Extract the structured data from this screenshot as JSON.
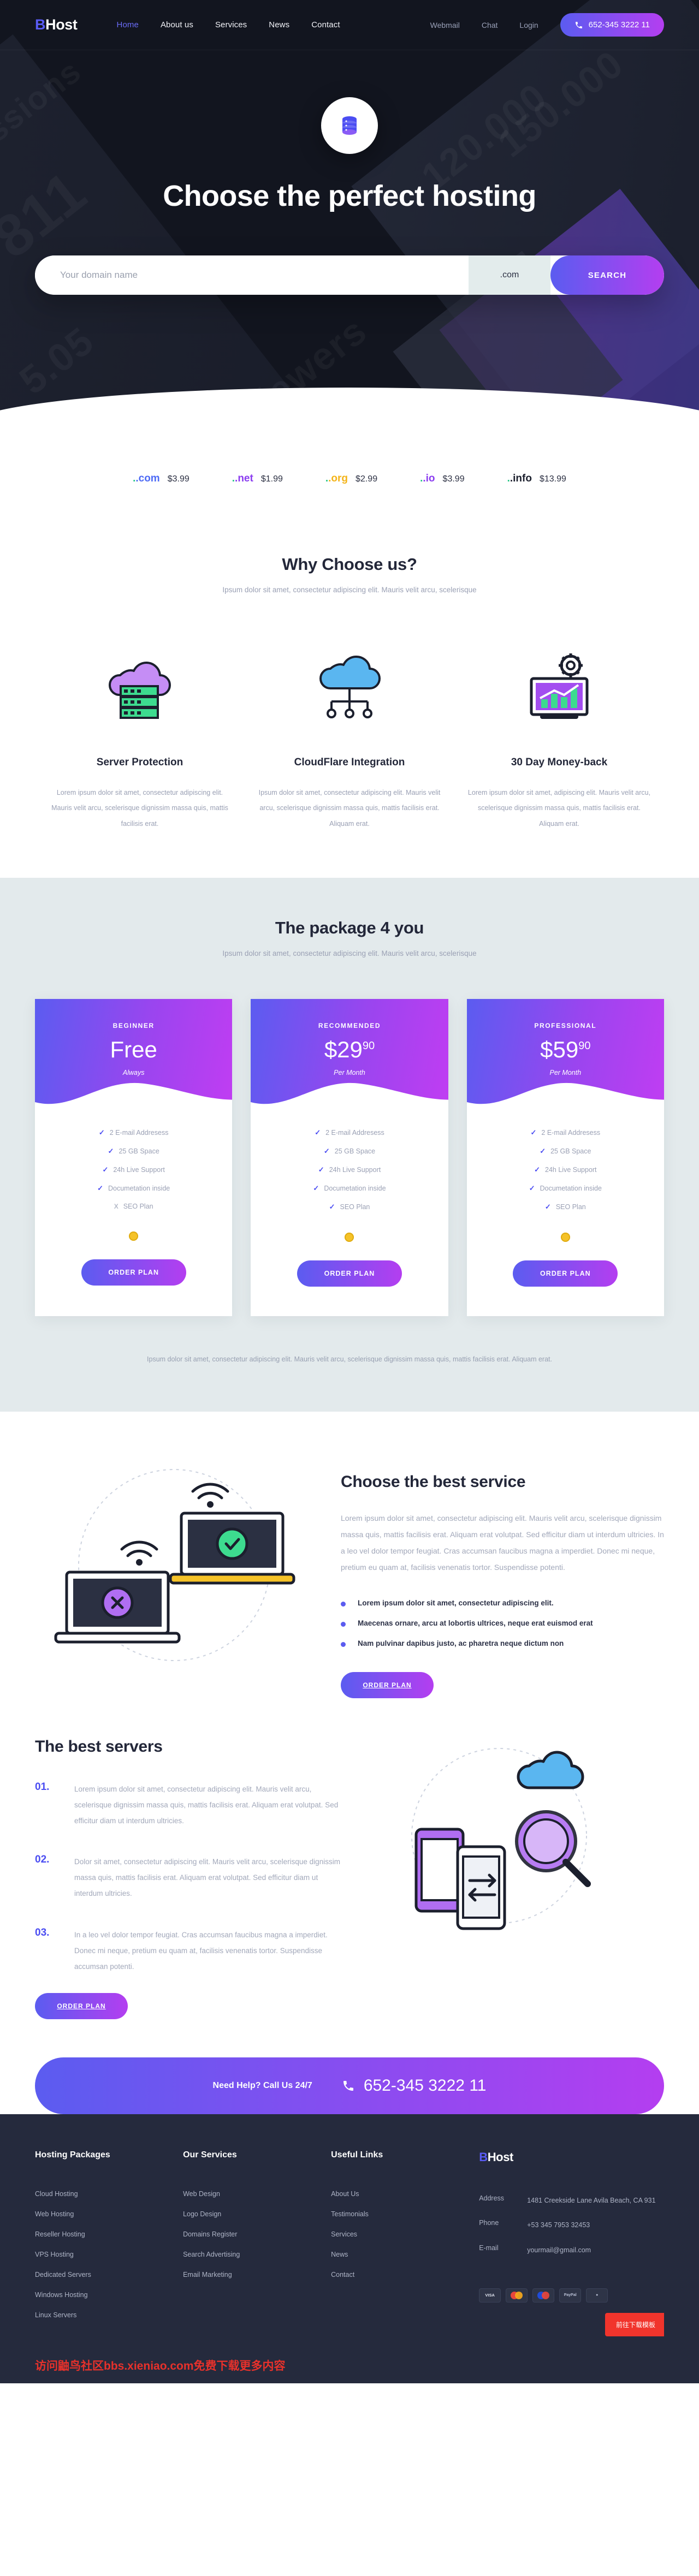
{
  "brand": {
    "prefix": "B",
    "suffix": "Host",
    "accent": "#5a5cf5"
  },
  "header": {
    "nav": [
      {
        "label": "Home",
        "active": true
      },
      {
        "label": "About us",
        "active": false
      },
      {
        "label": "Services",
        "active": false
      },
      {
        "label": "News",
        "active": false
      },
      {
        "label": "Contact",
        "active": false
      }
    ],
    "utility": [
      "Webmail",
      "Chat",
      "Login"
    ],
    "phone": "652-345 3222 11"
  },
  "hero": {
    "title": "Choose the perfect hosting",
    "bg_numbers": [
      "811",
      "5.05",
      "150.000",
      "120.000",
      "ssions",
      "viewers"
    ],
    "search": {
      "placeholder": "Your domain name",
      "value": "",
      "tld": ".com",
      "button": "SEARCH"
    }
  },
  "tlds": [
    {
      "name": ".com",
      "price": "$3.99",
      "color": "#4e6bf5"
    },
    {
      "name": ".net",
      "price": "$1.99",
      "color": "#8b3df0"
    },
    {
      "name": ".org",
      "price": "$2.99",
      "color": "#f4b41a"
    },
    {
      "name": ".io",
      "price": "$3.99",
      "color": "#8b3df0"
    },
    {
      "name": ".info",
      "price": "$13.99",
      "color": "#1b1f2d"
    }
  ],
  "why": {
    "title": "Why Choose us?",
    "subtitle": "Ipsum dolor sit amet, consectetur adipiscing elit. Mauris velit arcu, scelerisque",
    "features": [
      {
        "icon": "cloud-server-icon",
        "title": "Server Protection",
        "text": "Lorem ipsum dolor sit amet, consectetur adipiscing elit. Mauris velit arcu, scelerisque dignissim massa quis, mattis facilisis erat."
      },
      {
        "icon": "cloudflare-network-icon",
        "title": "CloudFlare Integration",
        "text": "Ipsum dolor sit amet, consectetur adipiscing elit. Mauris velit arcu, scelerisque dignissim massa quis, mattis facilisis erat. Aliquam erat."
      },
      {
        "icon": "money-back-chart-icon",
        "title": "30 Day Money-back",
        "text": "Lorem ipsum dolor sit amet, adipiscing elit. Mauris velit arcu, scelerisque dignissim massa quis, mattis facilisis erat. Aliquam erat."
      }
    ]
  },
  "pricing": {
    "title": "The package 4 you",
    "subtitle": "Ipsum dolor sit amet, consectetur adipiscing elit. Mauris velit arcu, scelerisque",
    "note": "Ipsum dolor sit amet, consectetur adipiscing elit. Mauris velit arcu, scelerisque dignissim massa quis, mattis facilisis erat. Aliquam erat.",
    "order_label": "ORDER PLAN",
    "plans": [
      {
        "tag": "BEGINNER",
        "price": "Free",
        "cents": "",
        "period": "Always",
        "features": [
          {
            "label": "2 E-mail Addresess",
            "included": true
          },
          {
            "label": "25 GB Space",
            "included": true
          },
          {
            "label": "24h Live Support",
            "included": true
          },
          {
            "label": "Documetation inside",
            "included": true
          },
          {
            "label": "SEO Plan",
            "included": false
          }
        ]
      },
      {
        "tag": "RECOMMENDED",
        "price": "$29",
        "cents": "90",
        "period": "Per Month",
        "features": [
          {
            "label": "2 E-mail Addresess",
            "included": true
          },
          {
            "label": "25 GB Space",
            "included": true
          },
          {
            "label": "24h Live Support",
            "included": true
          },
          {
            "label": "Documetation inside",
            "included": true
          },
          {
            "label": "SEO Plan",
            "included": true
          }
        ]
      },
      {
        "tag": "PROFESSIONAL",
        "price": "$59",
        "cents": "90",
        "period": "Per Month",
        "features": [
          {
            "label": "2 E-mail Addresess",
            "included": true
          },
          {
            "label": "25 GB Space",
            "included": true
          },
          {
            "label": "24h Live Support",
            "included": true
          },
          {
            "label": "Documetation inside",
            "included": true
          },
          {
            "label": "SEO Plan",
            "included": true
          }
        ]
      }
    ]
  },
  "service": {
    "title": "Choose the best service",
    "lead": "Lorem ipsum dolor sit amet, consectetur adipiscing elit. Mauris velit arcu, scelerisque dignissim massa quis, mattis facilisis erat. Aliquam erat volutpat. Sed efficitur diam ut interdum ultricies. In a leo vel dolor tempor feugiat. Cras accumsan faucibus magna a imperdiet. Donec mi neque, pretium eu quam at, facilisis venenatis tortor. Suspendisse potenti.",
    "bullets": [
      "Lorem ipsum dolor sit amet, consectetur adipiscing elit.",
      "Maecenas ornare, arcu at lobortis ultrices, neque erat euismod erat",
      "Nam pulvinar dapibus justo, ac pharetra neque dictum non"
    ],
    "button": "ORDER PLAN"
  },
  "servers": {
    "title": "The best servers",
    "button": "ORDER PLAN",
    "items": [
      {
        "num": "01.",
        "text": "Lorem ipsum dolor sit amet, consectetur adipiscing elit. Mauris velit arcu, scelerisque dignissim massa quis, mattis facilisis erat. Aliquam erat volutpat. Sed efficitur diam ut interdum ultricies."
      },
      {
        "num": "02.",
        "text": "Dolor sit amet, consectetur adipiscing elit. Mauris velit arcu, scelerisque dignissim massa quis, mattis facilisis erat. Aliquam erat volutpat. Sed efficitur diam ut interdum ultricies."
      },
      {
        "num": "03.",
        "text": "In a leo vel dolor tempor feugiat. Cras accumsan faucibus magna a imperdiet. Donec mi neque, pretium eu quam at, facilisis venenatis tortor. Suspendisse accumsan potenti."
      }
    ]
  },
  "cta": {
    "label": "Need Help? Call Us 24/7",
    "phone": "652-345 3222 11"
  },
  "footer": {
    "columns": [
      {
        "title": "Hosting Packages",
        "links": [
          "Cloud Hosting",
          "Web Hosting",
          "Reseller Hosting",
          "VPS Hosting",
          "Dedicated Servers",
          "Windows Hosting",
          "Linux Servers"
        ]
      },
      {
        "title": "Our Services",
        "links": [
          "Web Design",
          "Logo Design",
          "Domains Register",
          "Search Advertising",
          "Email Marketing"
        ]
      },
      {
        "title": "Useful Links",
        "links": [
          "About Us",
          "Testimonials",
          "Services",
          "News",
          "Contact"
        ]
      }
    ],
    "contact": {
      "rows": [
        {
          "key": "Address",
          "value": "1481 Creekside Lane Avila Beach, CA 931"
        },
        {
          "key": "Phone",
          "value": "+53 345 7953 32453"
        },
        {
          "key": "E-mail",
          "value": "yourmail@gmail.com"
        }
      ]
    },
    "cards": [
      "VISA",
      "MasterCard",
      "Maestro",
      "PayPal",
      "Discover"
    ]
  },
  "watermark": {
    "bottom": "访问鼬鸟社区bbs.xieniao.com免费下载更多内容",
    "chip": "前往下载模板"
  }
}
